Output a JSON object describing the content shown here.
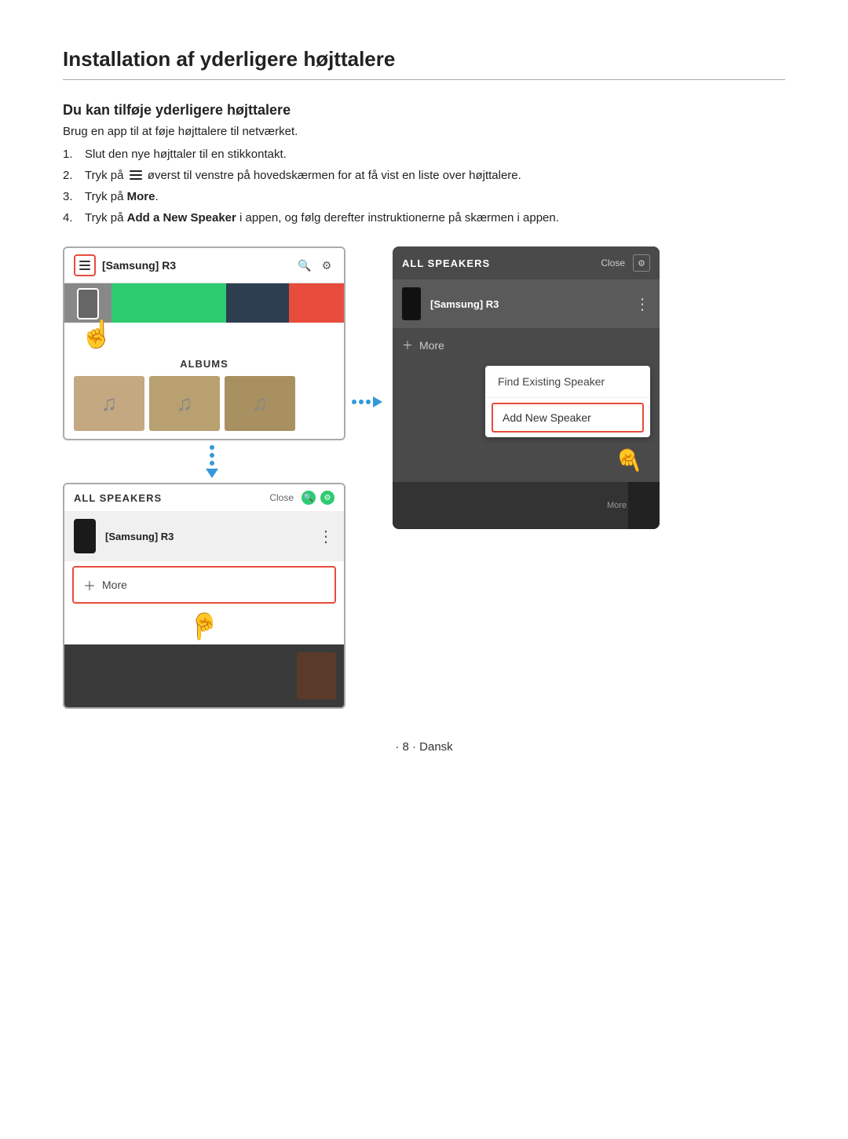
{
  "title": "Installation af yderligere højttalere",
  "section_title": "Du kan tilføje yderligere højttalere",
  "intro": "Brug en app til at føje højttalere til netværket.",
  "steps": [
    {
      "num": "1.",
      "text": "Slut den nye højttaler til en stikkontakt."
    },
    {
      "num": "2.",
      "text_before": "Tryk på",
      "icon": "hamburger",
      "text_after": "øverst til venstre på hovedskærmen for at få vist en liste over højttalere."
    },
    {
      "num": "3.",
      "text_before": "Tryk på",
      "bold": "More",
      "text_after": "."
    },
    {
      "num": "4.",
      "text_before": "Tryk på",
      "bold": "Add a New Speaker",
      "text_after": "i appen, og følg derefter instruktionerne på skærmen i appen."
    }
  ],
  "app_name": "[Samsung] R3",
  "albums_title": "ALBUMS",
  "all_speakers_label": "ALL SPEAKERS",
  "close_label": "Close",
  "speaker_name": "[Samsung] R3",
  "more_label": "More",
  "find_existing_speaker": "Find Existing Speaker",
  "add_new_speaker": "Add New Speaker",
  "page_number": "· 8 · Dansk",
  "colors": {
    "red_accent": "#e74c3c",
    "blue_arrow": "#3498db",
    "green": "#2ecc71",
    "dark_navy": "#2c3e50",
    "gray_panel": "#555555"
  }
}
